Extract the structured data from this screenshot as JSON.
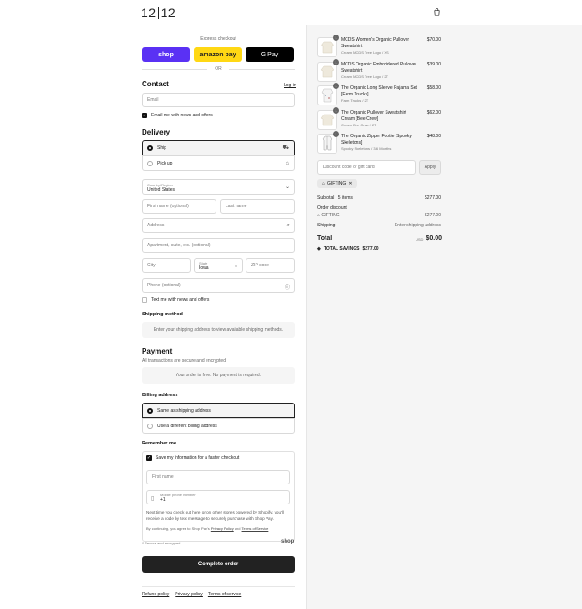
{
  "brand": {
    "logo_left": "12",
    "logo_right": "12"
  },
  "express": {
    "title": "Express checkout",
    "shop": "shop",
    "amazon": "amazon pay",
    "gpay": "G Pay",
    "or": "OR"
  },
  "contact": {
    "heading": "Contact",
    "login": "Log in",
    "email_placeholder": "Email",
    "news_label": "Email me with news and offers",
    "news_checked": true
  },
  "delivery": {
    "heading": "Delivery",
    "options": [
      {
        "label": "Ship",
        "selected": true,
        "icon": "truck-icon"
      },
      {
        "label": "Pick up",
        "selected": false,
        "icon": "store-icon"
      }
    ],
    "country_label": "Country/Region",
    "country_value": "United States",
    "first_name": "First name (optional)",
    "last_name": "Last name",
    "address": "Address",
    "apartment": "Apartment, suite, etc. (optional)",
    "city": "City",
    "state_label": "State",
    "state_value": "Iowa",
    "zip": "ZIP code",
    "phone": "Phone (optional)",
    "text_label": "Text me with news and offers"
  },
  "shipping_method": {
    "heading": "Shipping method",
    "message": "Enter your shipping address to view available shipping methods."
  },
  "payment": {
    "heading": "Payment",
    "subtitle": "All transactions are secure and encrypted.",
    "message": "Your order is free. No payment is required."
  },
  "billing": {
    "heading": "Billing address",
    "options": [
      {
        "label": "Same as shipping address",
        "selected": true
      },
      {
        "label": "Use a different billing address",
        "selected": false
      }
    ]
  },
  "remember": {
    "heading": "Remember me",
    "save_label": "Save my information for a faster checkout",
    "first_name": "First name",
    "mobile_label": "Mobile phone number",
    "mobile_value": "+1",
    "info": "Next time you check out here or on other stores powered by Shopify, you'll receive a code by text message to securely purchase with Shop Pay.",
    "terms_pre": "By continuing, you agree to Shop Pay's ",
    "privacy": "Privacy Policy",
    "terms_mid": " and ",
    "terms": "Terms of Service",
    "secure": "Secure and encrypted",
    "shop_logo": "shop"
  },
  "complete_button": "Complete order",
  "footer": {
    "refund": "Refund policy",
    "privacy": "Privacy policy",
    "terms": "Terms of service"
  },
  "cart": {
    "items": [
      {
        "qty": "1",
        "name": "MCDS Women's Organic Pullover Sweatshirt",
        "variant": "Cream MCDS Tree Logo / XS",
        "price": "$70.00"
      },
      {
        "qty": "1",
        "name": "MCDS Organic Embroidered Pullover Sweatshirt",
        "variant": "Cream MCDS Tree Logo / 2T",
        "price": "$39.00"
      },
      {
        "qty": "1",
        "name": "The Organic Long Sleeve Pajama Set [Farm Trucks]",
        "variant": "Farm Trucks / 2T",
        "price": "$58.00"
      },
      {
        "qty": "1",
        "name": "The Organic Pullover Sweatshirt Cream [Bee Crew]",
        "variant": "Cream Bee Crew / 2T",
        "price": "$62.00"
      },
      {
        "qty": "1",
        "name": "The Organic Zipper Footie [Spooky Skeletons]",
        "variant": "Spooky Skeletons / 3-6 Months",
        "price": "$48.00"
      }
    ],
    "discount_placeholder": "Discount code or gift card",
    "apply": "Apply",
    "tag": "GIFTING",
    "subtotal_label": "Subtotal · 5 items",
    "subtotal": "$277.00",
    "order_discount": "Order discount",
    "discount_code": "GIFTING",
    "discount_value": "- $277.00",
    "shipping_label": "Shipping",
    "shipping_value": "Enter shipping address",
    "total_label": "Total",
    "currency": "USD",
    "total": "$0.00",
    "savings_label": "TOTAL SAVINGS",
    "savings": "$277.00"
  }
}
